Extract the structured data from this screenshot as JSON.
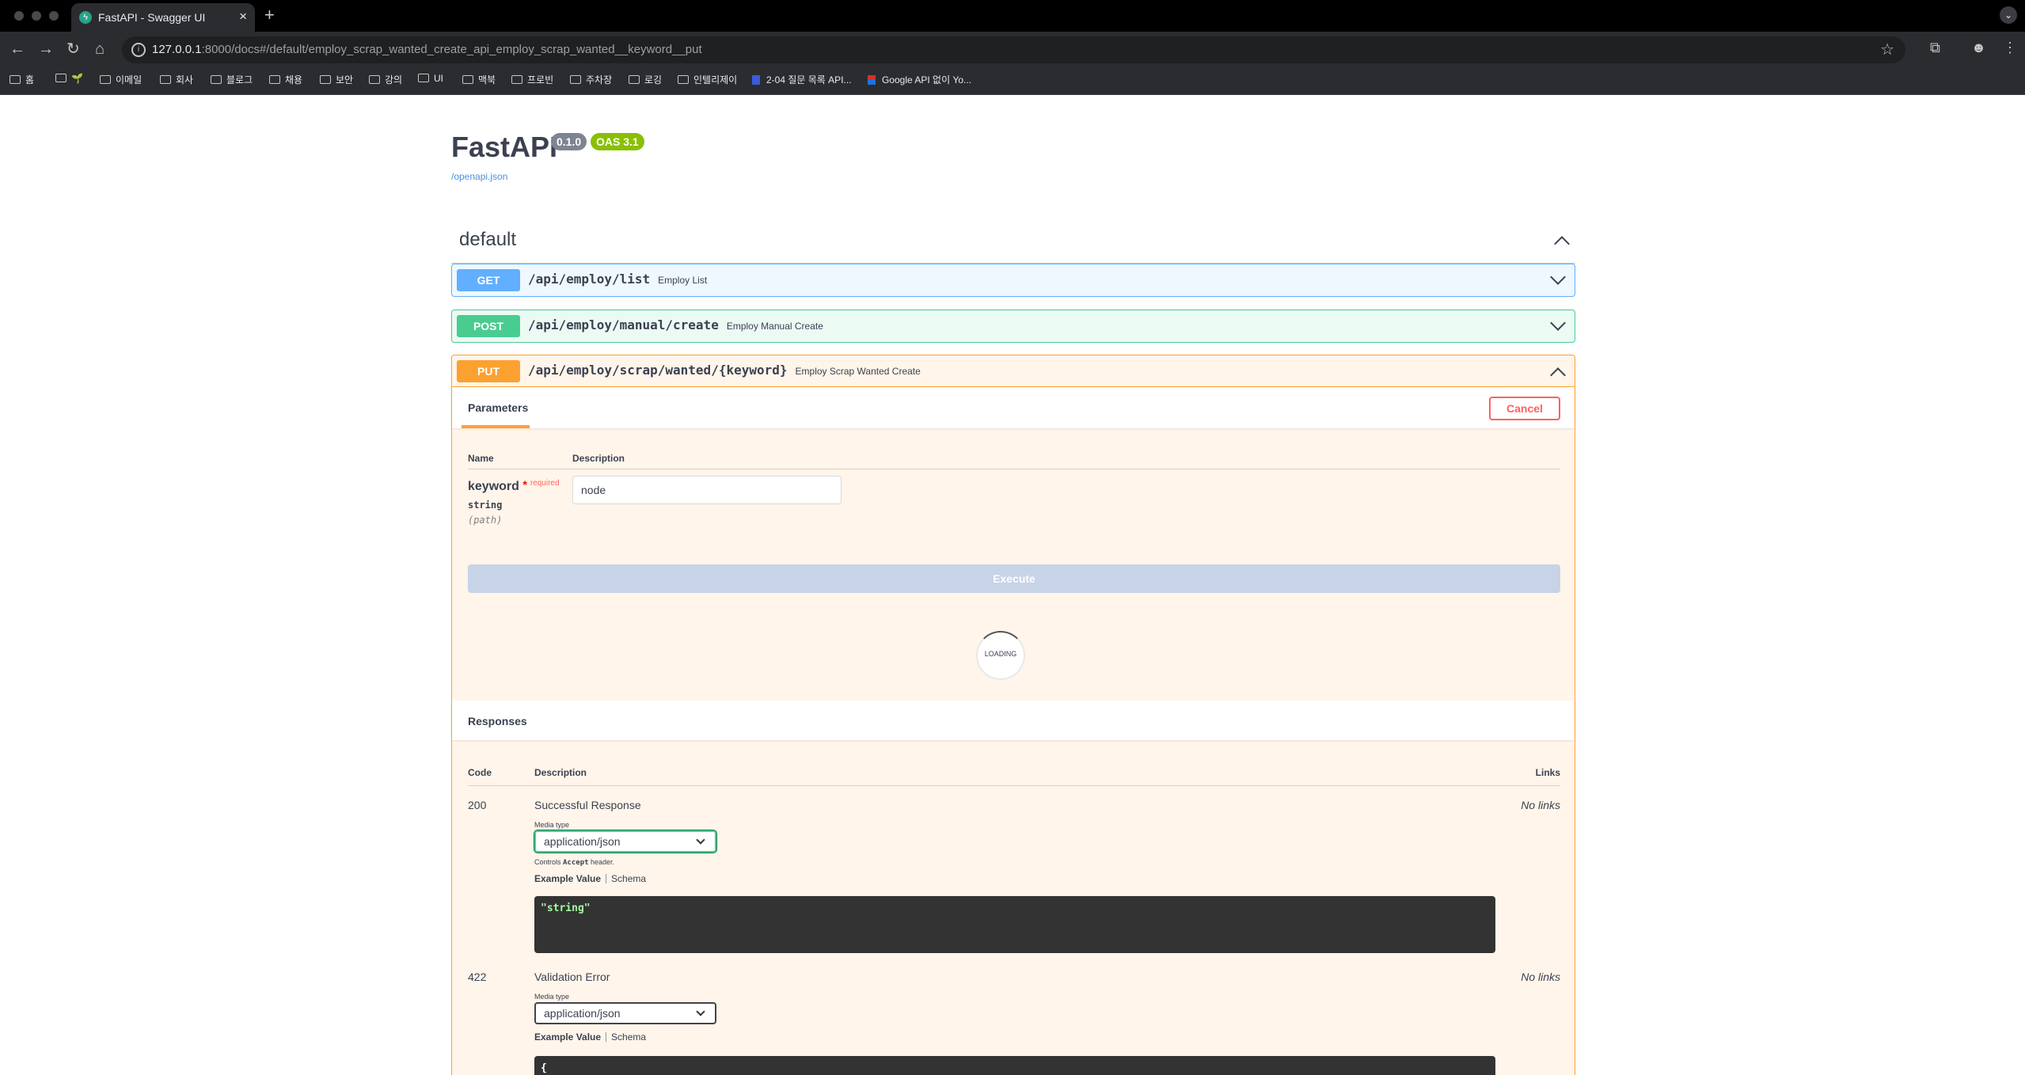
{
  "browser": {
    "tab_title": "FastAPI - Swagger UI",
    "url_host": "127.0.0.1",
    "url_rest": ":8000/docs#/default/employ_scrap_wanted_create_api_employ_scrap_wanted__keyword__put",
    "bookmarks": [
      "홈",
      "🌱",
      "이메일",
      "회사",
      "블로그",
      "채용",
      "보안",
      "강의",
      "UI",
      "맥북",
      "프로빈",
      "주차장",
      "로깅",
      "인텔리제이",
      "2-04 질문 목록 API...",
      "Google API 없이 Yo..."
    ]
  },
  "header": {
    "title": "FastAPI",
    "version_badge": "0.1.0",
    "oas_badge": "OAS 3.1",
    "spec_link": "/openapi.json"
  },
  "tag": {
    "name": "default"
  },
  "operations": [
    {
      "method": "GET",
      "path": "/api/employ/list",
      "summary": "Employ List"
    },
    {
      "method": "POST",
      "path": "/api/employ/manual/create",
      "summary": "Employ Manual Create"
    },
    {
      "method": "PUT",
      "path": "/api/employ/scrap/wanted/{keyword}",
      "summary": "Employ Scrap Wanted Create"
    }
  ],
  "put_detail": {
    "parameters_tab": "Parameters",
    "cancel_label": "Cancel",
    "col_name": "Name",
    "col_description": "Description",
    "param_name": "keyword",
    "param_star": "*",
    "param_required": "required",
    "param_type": "string",
    "param_in": "(path)",
    "param_value": "node",
    "execute_label": "Execute",
    "loading_label": "LOADING",
    "responses_title": "Responses",
    "col_code": "Code",
    "col_links": "Links",
    "responses": [
      {
        "code": "200",
        "description": "Successful Response",
        "links": "No links",
        "media_type_label": "Media type",
        "media_type": "application/json",
        "controls_prefix": "Controls ",
        "controls_code": "Accept",
        "controls_suffix": " header.",
        "example_tab": "Example Value",
        "schema_tab": "Schema",
        "example": "\"string\""
      },
      {
        "code": "422",
        "description": "Validation Error",
        "links": "No links",
        "media_type_label": "Media type",
        "media_type": "application/json",
        "example_tab": "Example Value",
        "schema_tab": "Schema",
        "example": "{"
      }
    ]
  },
  "colors": {
    "get": "#61affe",
    "post": "#49cc90",
    "put": "#fca130",
    "version_badge": "#7d8492",
    "oas_badge": "#89bf04"
  }
}
